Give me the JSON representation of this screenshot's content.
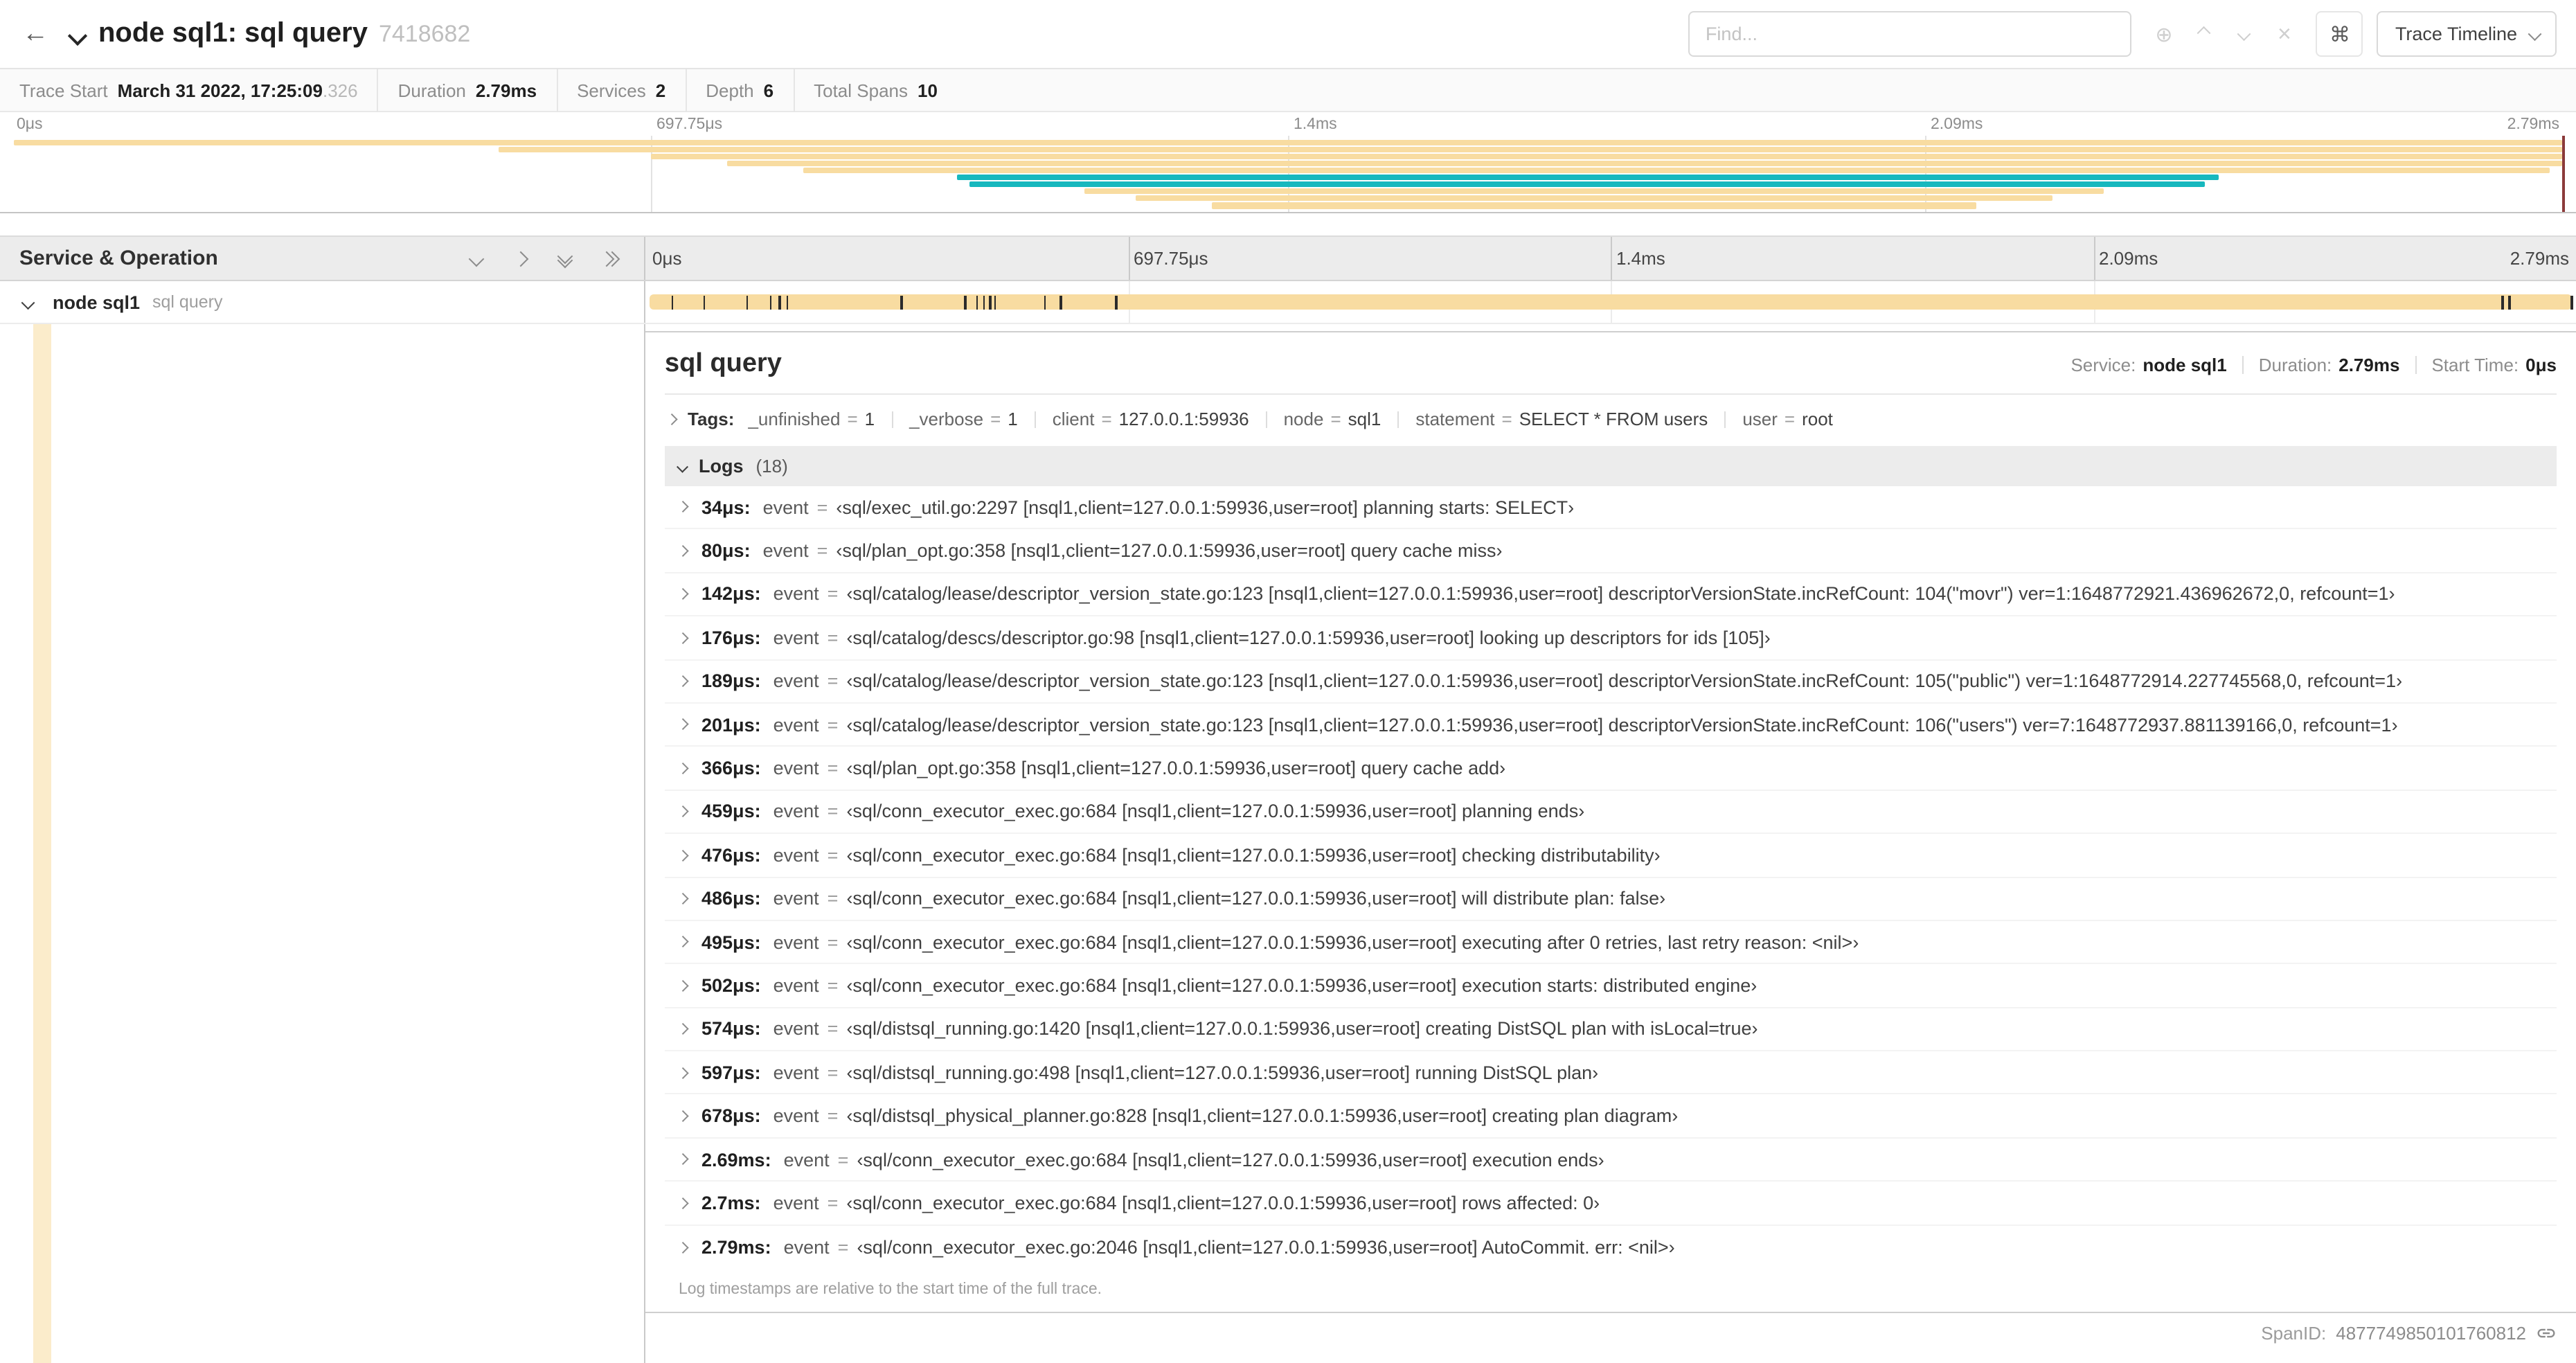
{
  "accent_colors": {
    "tan": "#F8DCA1",
    "teal": "#17B8BE",
    "tan_tint": "rgba(248,220,161,0.55)",
    "scrubber": "#8b3a3a"
  },
  "header": {
    "title": "node sql1: sql query",
    "trace_id_short": "7418682",
    "find": {
      "placeholder": "Find...",
      "shortcut_button": "⌘",
      "view_button": "Trace Timeline",
      "focus_icon": "⊕",
      "clear_icon": "×"
    },
    "back_icon": "←"
  },
  "trace_stats": [
    {
      "label": "Trace Start",
      "value": "March 31 2022, 17:25:09",
      "muted_suffix": ".326"
    },
    {
      "label": "Duration",
      "value": "2.79ms"
    },
    {
      "label": "Services",
      "value": "2"
    },
    {
      "label": "Depth",
      "value": "6"
    },
    {
      "label": "Total Spans",
      "value": "10"
    }
  ],
  "timeline": {
    "tick_labels": [
      "0μs",
      "697.75μs",
      "1.4ms",
      "2.09ms",
      "2.79ms"
    ],
    "total_duration_us": 2790
  },
  "minimap_spans": [
    {
      "row": 0,
      "start": 0,
      "end": 100,
      "color": "tan"
    },
    {
      "row": 1,
      "start": 19,
      "end": 100,
      "color": "tan"
    },
    {
      "row": 2,
      "start": 25,
      "end": 100,
      "color": "tan"
    },
    {
      "row": 3,
      "start": 28,
      "end": 100,
      "color": "tan"
    },
    {
      "row": 4,
      "start": 31,
      "end": 99.5,
      "color": "tan"
    },
    {
      "row": 5,
      "start": 37,
      "end": 86.5,
      "color": "teal"
    },
    {
      "row": 6,
      "start": 37.5,
      "end": 86,
      "color": "teal"
    },
    {
      "row": 7,
      "start": 42,
      "end": 82,
      "color": "tan"
    },
    {
      "row": 8,
      "start": 44,
      "end": 80,
      "color": "tan"
    },
    {
      "row": 9,
      "start": 47,
      "end": 77,
      "color": "tan"
    }
  ],
  "left_panel": {
    "title": "Service & Operation"
  },
  "span_row": {
    "service": "node sql1",
    "operation": "sql query",
    "log_tick_us": [
      34,
      80,
      142,
      176,
      189,
      201,
      366,
      459,
      476,
      486,
      495,
      502,
      574,
      597,
      678,
      2690,
      2700,
      2790
    ]
  },
  "detail": {
    "title": "sql query",
    "meta": [
      {
        "label": "Service:",
        "value": "node sql1"
      },
      {
        "label": "Duration:",
        "value": "2.79ms"
      },
      {
        "label": "Start Time:",
        "value": "0μs"
      }
    ],
    "tags_label": "Tags:",
    "kv_separator": "=",
    "tags": [
      {
        "key": "_unfinished",
        "value": "1"
      },
      {
        "key": "_verbose",
        "value": "1"
      },
      {
        "key": "client",
        "value": "127.0.0.1:59936"
      },
      {
        "key": "node",
        "value": "sql1"
      },
      {
        "key": "statement",
        "value": "SELECT * FROM users"
      },
      {
        "key": "user",
        "value": "root"
      }
    ],
    "logs_label": "Logs",
    "logs_count": "(18)",
    "logs": [
      {
        "t": "34μs:",
        "field": "event",
        "value": "‹sql/exec_util.go:2297 [nsql1,client=127.0.0.1:59936,user=root] planning starts: SELECT›"
      },
      {
        "t": "80μs:",
        "field": "event",
        "value": "‹sql/plan_opt.go:358 [nsql1,client=127.0.0.1:59936,user=root] query cache miss›"
      },
      {
        "t": "142μs:",
        "field": "event",
        "value": "‹sql/catalog/lease/descriptor_version_state.go:123 [nsql1,client=127.0.0.1:59936,user=root] descriptorVersionState.incRefCount: 104(\"movr\") ver=1:1648772921.436962672,0, refcount=1›"
      },
      {
        "t": "176μs:",
        "field": "event",
        "value": "‹sql/catalog/descs/descriptor.go:98 [nsql1,client=127.0.0.1:59936,user=root] looking up descriptors for ids [105]›"
      },
      {
        "t": "189μs:",
        "field": "event",
        "value": "‹sql/catalog/lease/descriptor_version_state.go:123 [nsql1,client=127.0.0.1:59936,user=root] descriptorVersionState.incRefCount: 105(\"public\") ver=1:1648772914.227745568,0, refcount=1›"
      },
      {
        "t": "201μs:",
        "field": "event",
        "value": "‹sql/catalog/lease/descriptor_version_state.go:123 [nsql1,client=127.0.0.1:59936,user=root] descriptorVersionState.incRefCount: 106(\"users\") ver=7:1648772937.881139166,0, refcount=1›"
      },
      {
        "t": "366μs:",
        "field": "event",
        "value": "‹sql/plan_opt.go:358 [nsql1,client=127.0.0.1:59936,user=root] query cache add›"
      },
      {
        "t": "459μs:",
        "field": "event",
        "value": "‹sql/conn_executor_exec.go:684 [nsql1,client=127.0.0.1:59936,user=root] planning ends›"
      },
      {
        "t": "476μs:",
        "field": "event",
        "value": "‹sql/conn_executor_exec.go:684 [nsql1,client=127.0.0.1:59936,user=root] checking distributability›"
      },
      {
        "t": "486μs:",
        "field": "event",
        "value": "‹sql/conn_executor_exec.go:684 [nsql1,client=127.0.0.1:59936,user=root] will distribute plan: false›"
      },
      {
        "t": "495μs:",
        "field": "event",
        "value": "‹sql/conn_executor_exec.go:684 [nsql1,client=127.0.0.1:59936,user=root] executing after 0 retries, last retry reason: <nil>›"
      },
      {
        "t": "502μs:",
        "field": "event",
        "value": "‹sql/conn_executor_exec.go:684 [nsql1,client=127.0.0.1:59936,user=root] execution starts: distributed engine›"
      },
      {
        "t": "574μs:",
        "field": "event",
        "value": "‹sql/distsql_running.go:1420 [nsql1,client=127.0.0.1:59936,user=root] creating DistSQL plan with isLocal=true›"
      },
      {
        "t": "597μs:",
        "field": "event",
        "value": "‹sql/distsql_running.go:498 [nsql1,client=127.0.0.1:59936,user=root] running DistSQL plan›"
      },
      {
        "t": "678μs:",
        "field": "event",
        "value": "‹sql/distsql_physical_planner.go:828 [nsql1,client=127.0.0.1:59936,user=root] creating plan diagram›"
      },
      {
        "t": "2.69ms:",
        "field": "event",
        "value": "‹sql/conn_executor_exec.go:684 [nsql1,client=127.0.0.1:59936,user=root] execution ends›"
      },
      {
        "t": "2.7ms:",
        "field": "event",
        "value": "‹sql/conn_executor_exec.go:684 [nsql1,client=127.0.0.1:59936,user=root] rows affected: 0›"
      },
      {
        "t": "2.79ms:",
        "field": "event",
        "value": "‹sql/conn_executor_exec.go:2046 [nsql1,client=127.0.0.1:59936,user=root] AutoCommit. err: <nil>›"
      }
    ],
    "footnote": "Log timestamps are relative to the start time of the full trace.",
    "span_id_label": "SpanID:",
    "span_id": "4877749850101760812"
  }
}
